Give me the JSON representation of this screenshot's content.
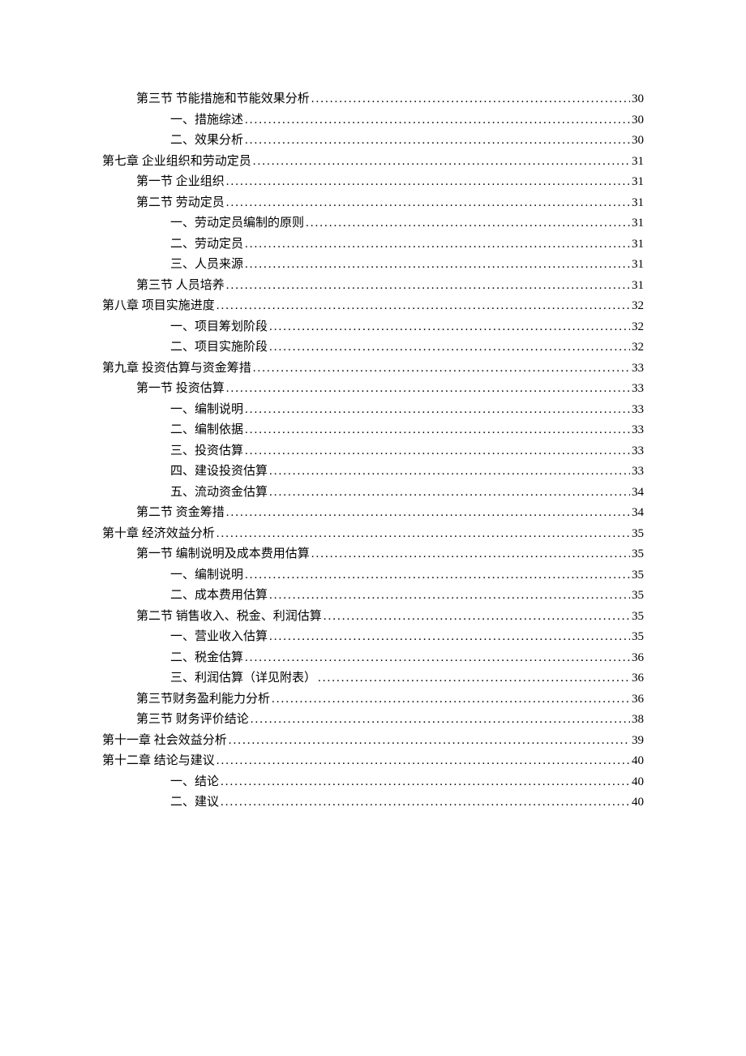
{
  "toc": [
    {
      "label": "第三节  节能措施和节能效果分析",
      "page": "30",
      "level": 1
    },
    {
      "label": "一、措施综述",
      "page": "30",
      "level": 2
    },
    {
      "label": "二、效果分析",
      "page": "30",
      "level": 2
    },
    {
      "label": "第七章  企业组织和劳动定员",
      "page": "31",
      "level": 0
    },
    {
      "label": "第一节  企业组织",
      "page": "31",
      "level": 1
    },
    {
      "label": "第二节  劳动定员",
      "page": "31",
      "level": 1
    },
    {
      "label": "一、劳动定员编制的原则",
      "page": "31",
      "level": 2
    },
    {
      "label": "二、劳动定员",
      "page": "31",
      "level": 2
    },
    {
      "label": "三、人员来源",
      "page": "31",
      "level": 2
    },
    {
      "label": "第三节  人员培养",
      "page": "31",
      "level": 1
    },
    {
      "label": "第八章  项目实施进度",
      "page": "32",
      "level": 0
    },
    {
      "label": "一、项目筹划阶段",
      "page": "32",
      "level": 2
    },
    {
      "label": "二、项目实施阶段",
      "page": "32",
      "level": 2
    },
    {
      "label": "第九章  投资估算与资金筹措",
      "page": "33",
      "level": 0
    },
    {
      "label": "第一节  投资估算",
      "page": "33",
      "level": 1
    },
    {
      "label": "一、编制说明",
      "page": "33",
      "level": 2
    },
    {
      "label": "二、编制依据",
      "page": "33",
      "level": 2
    },
    {
      "label": "三、投资估算",
      "page": "33",
      "level": 2
    },
    {
      "label": "四、建设投资估算",
      "page": "33",
      "level": 2
    },
    {
      "label": "五、流动资金估算",
      "page": "34",
      "level": 2
    },
    {
      "label": "第二节  资金筹措",
      "page": "34",
      "level": 1
    },
    {
      "label": "第十章  经济效益分析",
      "page": "35",
      "level": 0
    },
    {
      "label": "第一节  编制说明及成本费用估算",
      "page": "35",
      "level": 1
    },
    {
      "label": "一、编制说明",
      "page": "35",
      "level": 2
    },
    {
      "label": "二、成本费用估算",
      "page": "35",
      "level": 2
    },
    {
      "label": "第二节  销售收入、税金、利润估算",
      "page": "35",
      "level": 1
    },
    {
      "label": "一、营业收入估算",
      "page": "35",
      "level": 2
    },
    {
      "label": "二、税金估算",
      "page": "36",
      "level": 2
    },
    {
      "label": "三、利润估算（详见附表）",
      "page": "36",
      "level": 2
    },
    {
      "label": "第三节财务盈利能力分析",
      "page": "36",
      "level": 1
    },
    {
      "label": "第三节  财务评价结论",
      "page": "38",
      "level": 1
    },
    {
      "label": "第十一章  社会效益分析",
      "page": "39",
      "level": 0
    },
    {
      "label": "第十二章  结论与建议",
      "page": "40",
      "level": 0
    },
    {
      "label": "一、结论",
      "page": "40",
      "level": 2
    },
    {
      "label": "二、建议",
      "page": "40",
      "level": 2
    }
  ]
}
